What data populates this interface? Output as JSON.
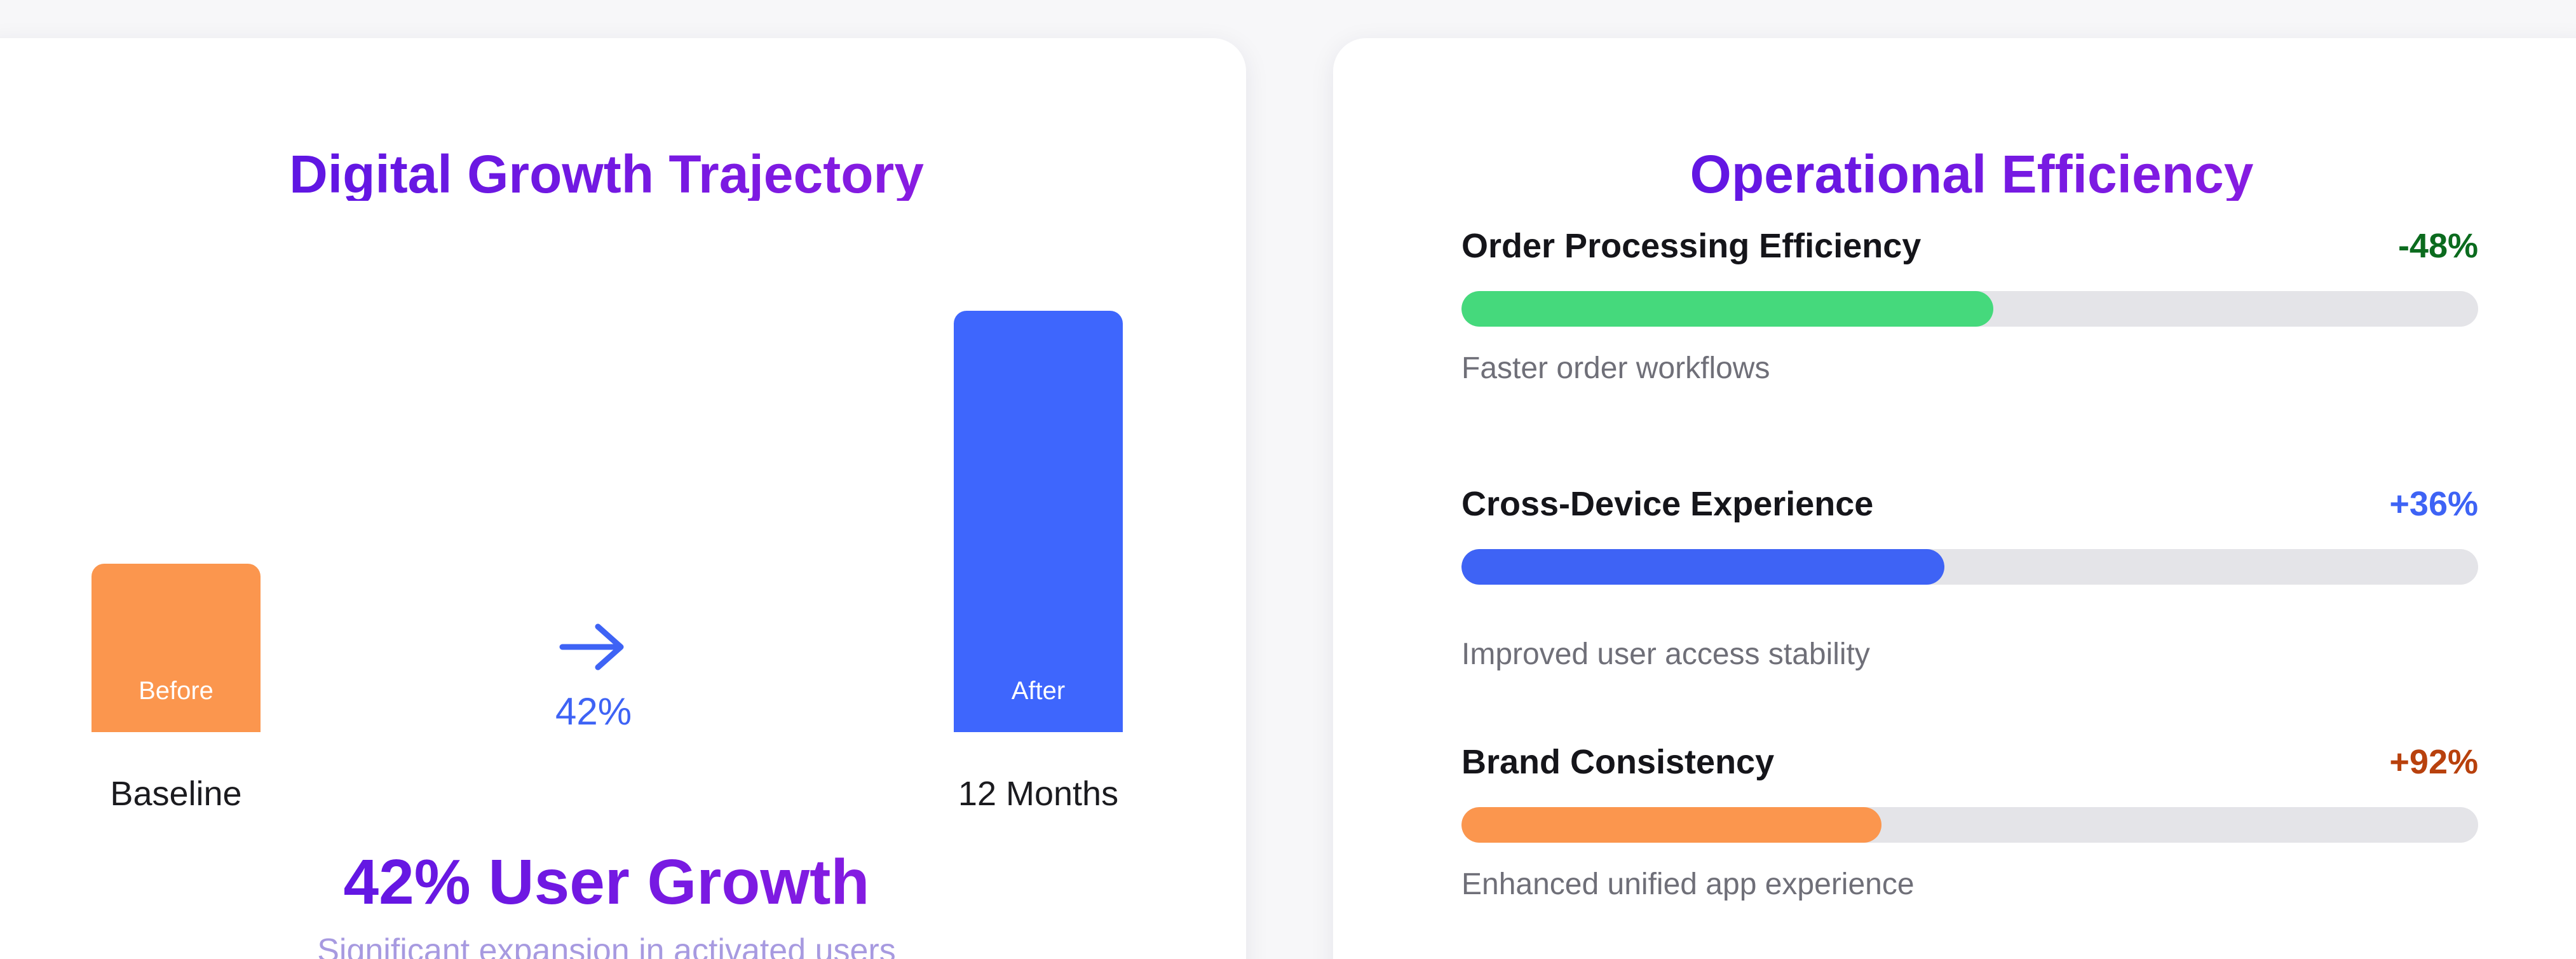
{
  "left_card": {
    "title": "Digital Growth Trajectory",
    "headline": "42% User Growth",
    "subline": "Significant expansion in activated users",
    "arrow_icon": "arrow-right-icon",
    "colors": {
      "before": "#fb964e",
      "after": "#3e66fd",
      "delta": "#3e63f5"
    }
  },
  "chart_data": {
    "type": "bar",
    "categories": [
      "Baseline",
      "12 Months"
    ],
    "bar_labels": [
      "Before",
      "After"
    ],
    "values": [
      100,
      250
    ],
    "change_label": "42%",
    "title": "Digital Growth Trajectory",
    "xlabel": "",
    "ylabel": "",
    "grid": false,
    "legend": "none"
  },
  "right_card": {
    "title": "Operational Efficiency",
    "metrics": [
      {
        "name": "Order Processing Efficiency",
        "value": "-48%",
        "value_color": "#0b6b1e",
        "fill_color": "#45d97c",
        "progress": 0.523,
        "description": "Faster order workflows"
      },
      {
        "name": "Cross-Device Experience",
        "value": "+36%",
        "value_color": "#3e63f5",
        "fill_color": "#3e63f5",
        "progress": 0.475,
        "description": "Improved user access stability"
      },
      {
        "name": "Brand Consistency",
        "value": "+92%",
        "value_color": "#b8410d",
        "fill_color": "#fb964e",
        "progress": 0.413,
        "description": "Enhanced unified app experience"
      }
    ]
  }
}
